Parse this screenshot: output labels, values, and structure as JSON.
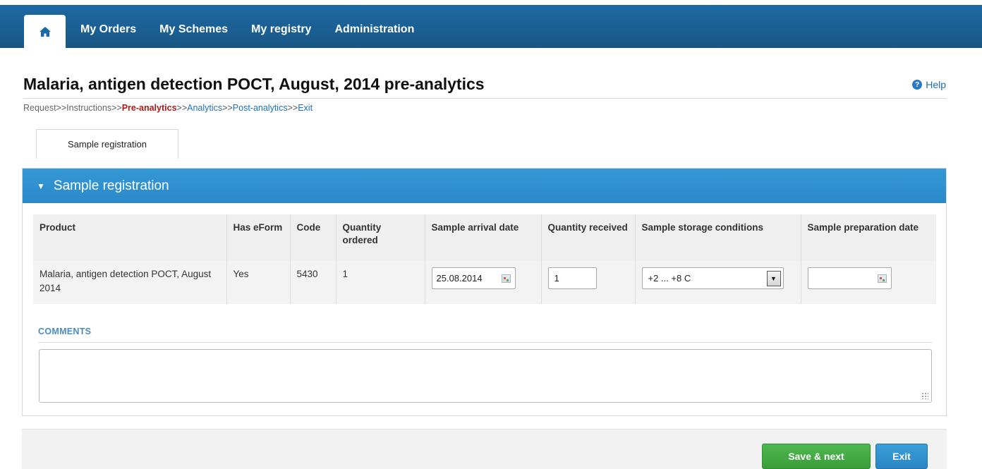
{
  "nav": {
    "home_icon": "home-icon",
    "items": [
      "My Orders",
      "My Schemes",
      "My registry",
      "Administration"
    ]
  },
  "page": {
    "title": "Malaria, antigen detection POCT, August, 2014 pre-analytics",
    "help_label": "Help"
  },
  "breadcrumb": {
    "items": [
      {
        "label": "Request",
        "state": "plain"
      },
      {
        "label": "Instructions",
        "state": "plain"
      },
      {
        "label": "Pre-analytics",
        "state": "active"
      },
      {
        "label": "Analytics",
        "state": "link"
      },
      {
        "label": "Post-analytics",
        "state": "link"
      },
      {
        "label": "Exit",
        "state": "link"
      }
    ],
    "separator": ">>"
  },
  "tabs": [
    {
      "label": "Sample registration"
    }
  ],
  "panel": {
    "title": "Sample registration",
    "table": {
      "headers": [
        "Product",
        "Has eForm",
        "Code",
        "Quantity ordered",
        "Sample arrival date",
        "Quantity received",
        "Sample storage conditions",
        "Sample preparation date"
      ],
      "rows": [
        {
          "product": "Malaria, antigen detection POCT, August 2014",
          "has_eform": "Yes",
          "code": "5430",
          "quantity_ordered": "1",
          "arrival_date": "25.08.2014",
          "quantity_received": "1",
          "storage": "+2 ... +8 C",
          "preparation_date": ""
        }
      ]
    },
    "comments_label": "COMMENTS",
    "comments_value": ""
  },
  "footer": {
    "save_label": "Save & next",
    "exit_label": "Exit"
  },
  "colors": {
    "nav_blue": "#1b5f93",
    "panel_blue": "#2989c9",
    "active_crumb": "#b01818",
    "save_green": "#3a9e3a",
    "exit_blue": "#2a86c4"
  }
}
